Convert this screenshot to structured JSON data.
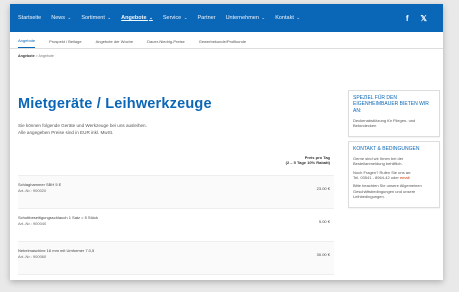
{
  "nav": {
    "items": [
      {
        "label": "Startseite",
        "chev": ""
      },
      {
        "label": "News",
        "chev": "⌄"
      },
      {
        "label": "Sortiment",
        "chev": "⌄"
      },
      {
        "label": "Angebote",
        "chev": "⌄"
      },
      {
        "label": "Service",
        "chev": "⌄"
      },
      {
        "label": "Partner",
        "chev": ""
      },
      {
        "label": "Unternehmen",
        "chev": "⌄"
      },
      {
        "label": "Kontakt",
        "chev": "⌄"
      }
    ],
    "active_index": 3,
    "social": {
      "facebook": "f",
      "twitter": "𝕏"
    }
  },
  "subnav": {
    "tabs": [
      "Angebote",
      "Prospekt / Beilage",
      "Angebote der Woche",
      "Dauer-Niedrig-Preise",
      "Gewerbekunde/Profikunde"
    ]
  },
  "breadcrumb": {
    "current": "Angebote",
    "sep": ">",
    "page": "Angebote"
  },
  "main": {
    "title": "Mietgeräte / Leihwerkzeuge",
    "intro_line1": "Sie können folgende Geräte und Werkzeuge bei uns ausleihen.",
    "intro_line2": "Alle angegeben Preise sind in EUR inkl. MwSt.",
    "table_header_line1": "Preis pro Tag",
    "table_header_line2": "(2 – 5 Tage 10% Rabatt)",
    "rows": [
      {
        "name": "Schlaghammer SBH 5 E",
        "sub": "Art.-Nr.: 900020",
        "price": "23.00 €"
      },
      {
        "name": "Schuttbeseitigungsschlauch 1 Satz = 5 Stück",
        "sub": "Art.-Nr.: 900040",
        "price": "5.00 €"
      },
      {
        "name": "Nebelmaschine 16 mm mit Umformer 7.0,5",
        "sub": "Art.-Nr.: 900060",
        "price": "30.00 €"
      }
    ]
  },
  "sidebar": {
    "box1": {
      "title": "SPEZIEL FÜR DEN EIGENHEIMBAUER BIETEN WIR AN:",
      "text": "Deckenabstützung für Fliegen- und Betondecken"
    },
    "box2": {
      "title": "KONTAKT & BEDINGUNGEN",
      "p1": "Gerne sind wir Ihnen bei der Bestellanmeldung behilflich.",
      "p2_pre": "Noch Fragen? Rufen Sie uns an:",
      "p2_tel": "Tel. 03541 - 8964-42 oder",
      "p2_link": "email",
      "p3": "Bitte beachten Sie unsere Allgemeinen Geschäftsbedingungen und unsere Leihbedingungen."
    }
  }
}
